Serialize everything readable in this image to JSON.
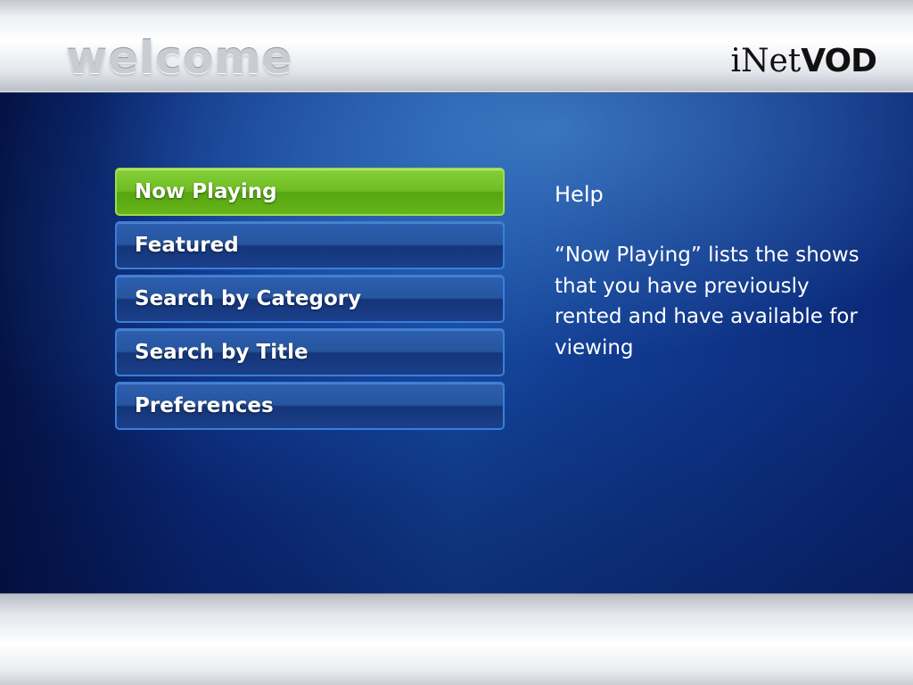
{
  "header": {
    "title": "welcome",
    "brand": {
      "prefix": "iNet",
      "suffix": "VOD"
    }
  },
  "menu": {
    "selected_index": 0,
    "items": [
      {
        "label": "Now Playing"
      },
      {
        "label": "Featured"
      },
      {
        "label": "Search by Category"
      },
      {
        "label": "Search by Title"
      },
      {
        "label": "Preferences"
      }
    ]
  },
  "help": {
    "title": "Help",
    "text": "“Now Playing” lists the shows that you have previously rented and have available for viewing"
  },
  "colors": {
    "selected_item": "#6dbd22",
    "menu_item": "#27559f",
    "menu_border": "#3b7fd6",
    "background_blue": "#134398"
  }
}
